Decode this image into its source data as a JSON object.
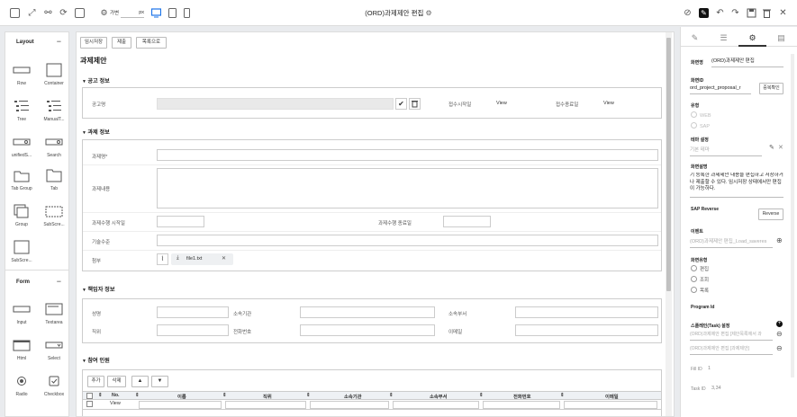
{
  "topbar": {
    "title": "(ORD)과제제안 편집",
    "device_label": "가변",
    "unit_label": "px"
  },
  "left_panel": {
    "layout_header": "Layout",
    "layout_items": [
      "Row",
      "Container",
      "Tree",
      "ManualT...",
      "unifiedS...",
      "Search",
      "Tab Group",
      "Tab",
      "Group",
      "SubScre...",
      "SubScre..."
    ],
    "form_header": "Form",
    "form_items": [
      "Input",
      "Textarea",
      "Html",
      "Select",
      "Radio",
      "Checkbox"
    ]
  },
  "main": {
    "buttons": {
      "save": "임시저장",
      "submit": "제출",
      "list": "목록으로"
    },
    "page_title": "과제제안",
    "notice_section": {
      "title": "공고 정보",
      "announcement_label": "공고명",
      "start_label": "접수시작일",
      "start_value": "View",
      "end_label": "접수종료일",
      "end_value": "View"
    },
    "task_section": {
      "title": "과제 정보",
      "name_label": "과제명*",
      "content_label": "과제내용",
      "start_label": "과제수행 시작일",
      "end_label": "과제수행 종료일",
      "tech_label": "기술수준",
      "attach_label": "첨부",
      "file_name": "file1.txt"
    },
    "owner_section": {
      "title": "책임자 정보",
      "name_label": "성명",
      "org_label": "소속기관",
      "dept_label": "소속부서",
      "position_label": "직위",
      "phone_label": "전화번호",
      "email_label": "이메일"
    },
    "participants_section": {
      "title": "참여 인원",
      "add_label": "추가",
      "delete_label": "삭제",
      "up_label": "▲",
      "down_label": "▼",
      "columns": [
        "No.",
        "이름",
        "직위",
        "소속기관",
        "소속부서",
        "전화번호",
        "이메일"
      ],
      "row_no": "View"
    }
  },
  "right_panel": {
    "screen_name_label": "화면명",
    "screen_name_value": "(ORD)과제제안 편집",
    "screen_id_label": "화면ID",
    "screen_id_value": "ord_project_proposal_r",
    "dup_check_label": "중복확인",
    "type_label": "유형",
    "type_options": [
      "WEB",
      "SAP"
    ],
    "theme_label": "테마 설정",
    "theme_placeholder": "기본 테마",
    "desc_label": "화면설명",
    "desc_value": "기 등록한 과제제안 내용을 편집하고 저장하거나 제출할 수 있다. 임시저장 상태에서만 편집이 가능하다.",
    "sap_reverse_label": "SAP Reverse",
    "reverse_button": "Reverse",
    "event_label": "이벤트",
    "event_value": "(ORD)과제제안 편집_Load_saveres",
    "screen_type_label": "화면유형",
    "screen_type_options": [
      "편집",
      "조회",
      "목록"
    ],
    "program_id_label": "Program Id",
    "task_settings_label": "스플레인(Task) 설정",
    "task_items": [
      "(ORD)과제제안 편집 [제안목록에서 과",
      "(ORD)과제제안 편집 [과제제안]"
    ],
    "fill_id_label": "Fill ID",
    "fill_id_value": "1",
    "task_id_label": "Task ID",
    "task_id_value": "3,34"
  }
}
